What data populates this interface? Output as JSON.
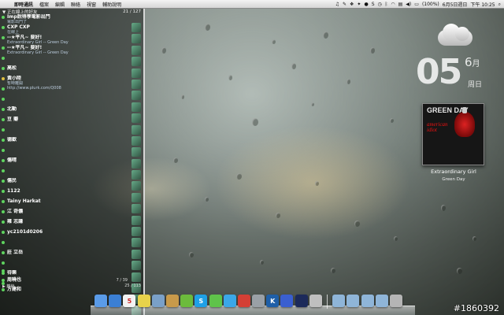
{
  "menubar": {
    "app_name": "即時通訊",
    "menus": [
      "檔案",
      "編輯",
      "聯絡",
      "視窗",
      "輔助說明"
    ],
    "battery": "(100%)",
    "date": "6月5日週日",
    "time": "下午 10:25"
  },
  "panel": {
    "group_header": "▼ 正在線上的好友",
    "count": "21 / 127",
    "contacts": [
      {
        "name": "Imp說得學電影出門",
        "status": "電影出門了",
        "away": false
      },
      {
        "name": "CXP CXP",
        "status": "在線上",
        "away": false
      },
      {
        "name": "--★平凡~ 要好!",
        "status": "Extraordinary Girl -- Green Day",
        "away": false
      },
      {
        "name": "--★平凡~ 要好!",
        "status": "Extraordinary Girl -- Green Day",
        "away": false
      },
      {
        "name": "",
        "status": "",
        "away": false
      },
      {
        "name": "高松",
        "status": "",
        "away": false
      },
      {
        "name": "黃小陸",
        "status": "暫時離開",
        "away": true
      },
      {
        "name": "",
        "status": "http://www.plurk.com/Q008",
        "away": false
      },
      {
        "name": "",
        "status": "",
        "away": false
      },
      {
        "name": "北動",
        "status": "",
        "away": false
      },
      {
        "name": "豆 瓣",
        "status": "",
        "away": false
      },
      {
        "name": "",
        "status": "",
        "away": false
      },
      {
        "name": "德歡",
        "status": "",
        "away": false
      },
      {
        "name": "",
        "status": "",
        "away": false
      },
      {
        "name": "傷晴",
        "status": "",
        "away": false
      },
      {
        "name": "",
        "status": "",
        "away": false
      },
      {
        "name": "傷民",
        "status": "",
        "away": false
      },
      {
        "name": "1122",
        "status": "",
        "away": false
      },
      {
        "name": "Tainy Harkat",
        "status": "",
        "away": false
      },
      {
        "name": "江 奇儀",
        "status": "",
        "away": false
      },
      {
        "name": "雍 志謙",
        "status": "",
        "away": false
      },
      {
        "name": "yc2101d0206",
        "status": "",
        "away": false
      },
      {
        "name": "",
        "status": "",
        "away": false
      },
      {
        "name": "莊 立岳",
        "status": "",
        "away": false
      },
      {
        "name": "",
        "status": "",
        "away": false
      },
      {
        "name": "待樂",
        "status": "",
        "away": false
      },
      {
        "name": "",
        "status": "",
        "away": false
      }
    ],
    "page_indicator": "7 / 39",
    "offline_header": "▶ 離線",
    "offline_count": "25 / 113",
    "bottom_contacts": [
      "",
      "周曉也",
      "方建和"
    ]
  },
  "widgets": {
    "weather_icon": "cloud-icon",
    "day": "05",
    "month": "6",
    "month_unit": "月",
    "weekday": "周日"
  },
  "now_playing": {
    "album_band": "GREEN DAY",
    "album_title": "american idiot",
    "song": "Extraordinary Girl",
    "artist": "Green Day"
  },
  "dock": {
    "apps": [
      {
        "name": "finder-icon",
        "label": "",
        "color": "#5a9be8"
      },
      {
        "name": "safari-icon",
        "label": "",
        "color": "#3b7fd4"
      },
      {
        "name": "calendar-icon",
        "label": "5",
        "color": "#f2f2f2"
      },
      {
        "name": "stickies-icon",
        "label": "",
        "color": "#e8d24a"
      },
      {
        "name": "preview-icon",
        "label": "",
        "color": "#7aa0c8"
      },
      {
        "name": "package-icon",
        "label": "",
        "color": "#c89a4a"
      },
      {
        "name": "adium-icon",
        "label": "",
        "color": "#6cbb3c"
      },
      {
        "name": "skype-icon",
        "label": "S",
        "color": "#1fa0e6"
      },
      {
        "name": "messages-icon",
        "label": "",
        "color": "#5fc34a"
      },
      {
        "name": "twitter-icon",
        "label": "",
        "color": "#3ba7e8"
      },
      {
        "name": "chrome-icon",
        "label": "",
        "color": "#d43f35"
      },
      {
        "name": "app-icon",
        "label": "",
        "color": "#9aa0a6"
      },
      {
        "name": "k-app-icon",
        "label": "K",
        "color": "#1f5fa8"
      },
      {
        "name": "itunes-icon",
        "label": "",
        "color": "#3a5fd0"
      },
      {
        "name": "music-icon",
        "label": "",
        "color": "#1c2a5a"
      },
      {
        "name": "utility-icon",
        "label": "",
        "color": "#bfbfbf"
      },
      {
        "name": "folder-icon",
        "label": "",
        "color": "#8fb5d8"
      },
      {
        "name": "folder-icon",
        "label": "",
        "color": "#8fb5d8"
      },
      {
        "name": "folder-icon",
        "label": "",
        "color": "#8fb5d8"
      },
      {
        "name": "folder-icon",
        "label": "",
        "color": "#8fb5d8"
      },
      {
        "name": "trash-icon",
        "label": "",
        "color": "#b5b5b5"
      }
    ]
  },
  "watermark": "#1860392"
}
